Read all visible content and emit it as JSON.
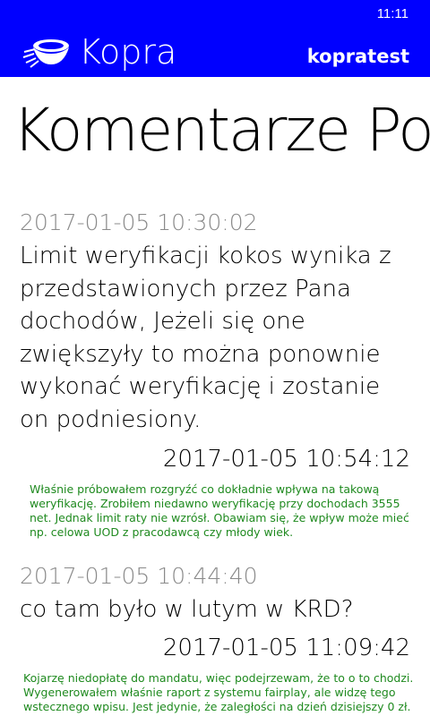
{
  "status_bar": {
    "time": "11:11"
  },
  "header": {
    "app_name": "Kopra",
    "user": "kopratest",
    "logo_icon": "kopra-logo-icon"
  },
  "page_title": "Komentarze Podsumowania",
  "comments": [
    {
      "question_date": "2017-01-05 10:30:02",
      "question_text": "Limit weryfikacji kokos wynika z przedstawionych przez Pana dochodów, Jeżeli się one zwiększyły to można ponownie wykonać weryfikację i zostanie on podniesiony.",
      "answer_date": "2017-01-05 10:54:12",
      "answer_text": "Właśnie próbowałem rozgryźć co dokładnie wpływa na takową weryfikację. Zrobiłem niedawno weryfikację przy dochodach 3555 net. Jednak limit raty nie wzrósł. Obawiam się, że wpływ może mieć np. celowa UOD z pracodawcą czy młody wiek."
    },
    {
      "question_date": "2017-01-05 10:44:40",
      "question_text": "co tam było w lutym w KRD?",
      "answer_date": "2017-01-05 11:09:42",
      "answer_text": "Kojarzę niedopłatę do mandatu, więc podejrzewam, że to o to chodzi. Wygenerowałem właśnie raport z systemu fairplay, ale widzę tego wstecznego wpisu. Jest jedynie, że zaległości na dzień dzisiejszy 0 zł."
    }
  ],
  "colors": {
    "header_bg": "#0000ff",
    "answer_text": "#1f8a1f",
    "date_gray": "#8a8a8a"
  }
}
